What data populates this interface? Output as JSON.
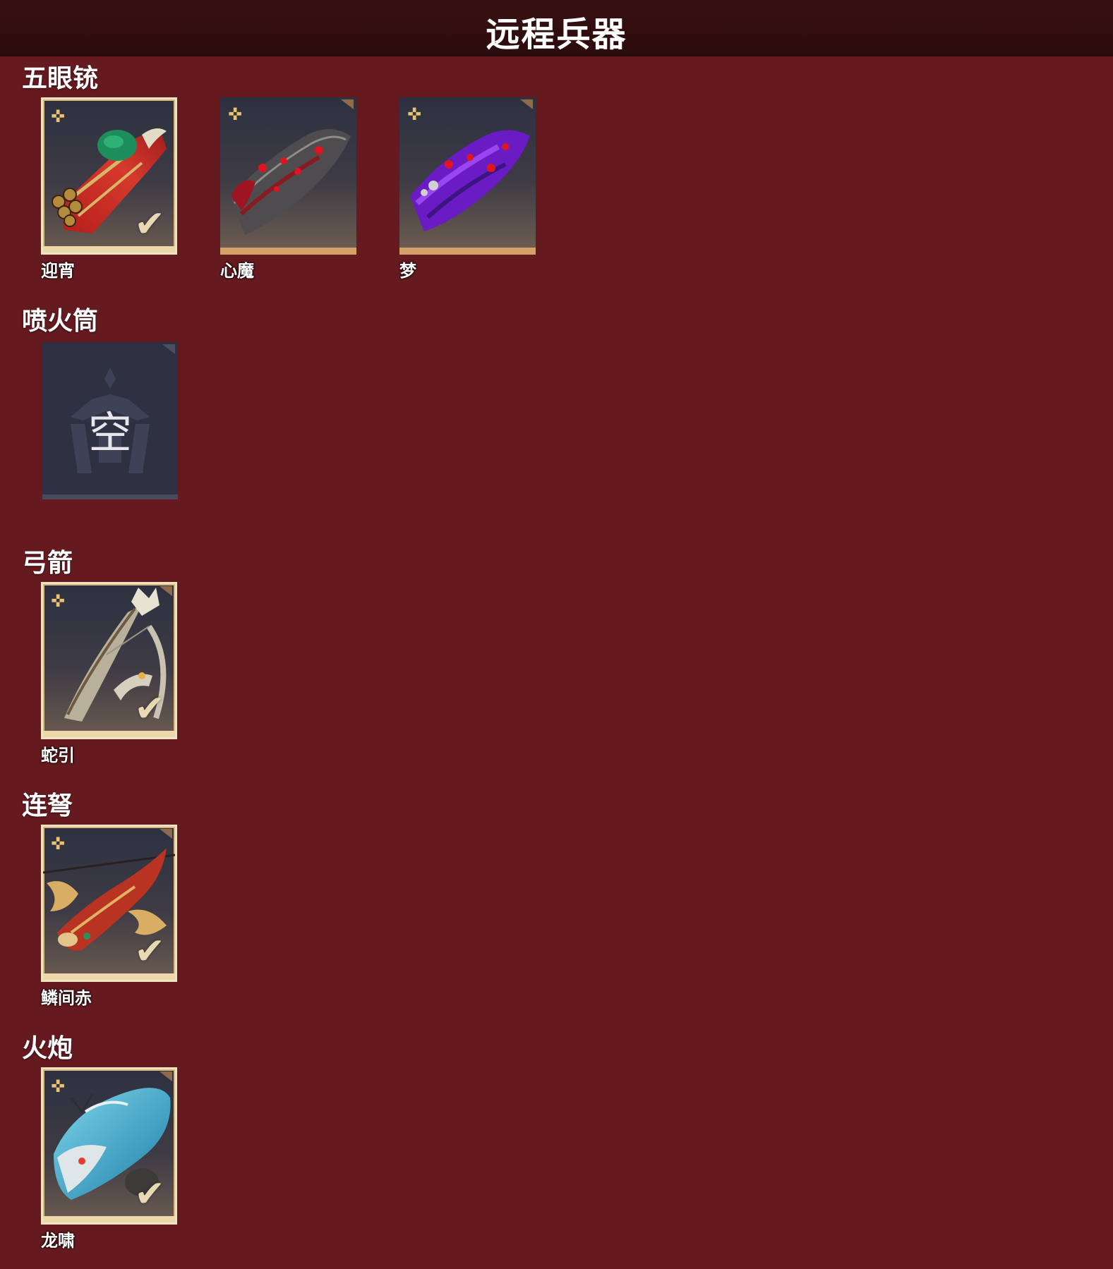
{
  "header": {
    "title": "远程兵器"
  },
  "sections": [
    {
      "title": "五眼铳",
      "items": [
        {
          "name": "迎宵",
          "selected": true,
          "icon": "gatling-gun-red-green-icon",
          "colors": [
            "#c3241e",
            "#1c8e5c",
            "#c9a24a"
          ]
        },
        {
          "name": "心魔",
          "selected": false,
          "icon": "gatling-gun-dark-red-icon",
          "colors": [
            "#7a1218",
            "#5d5b5c",
            "#d8141f"
          ]
        },
        {
          "name": "梦",
          "selected": false,
          "icon": "gatling-gun-purple-icon",
          "colors": [
            "#7b1fd6",
            "#3b1c73",
            "#d3151d"
          ]
        }
      ]
    },
    {
      "title": "喷火筒",
      "items": [
        {
          "name": "",
          "empty": true,
          "empty_text": "空",
          "icon": "empty-slot-icon"
        }
      ]
    },
    {
      "title": "弓箭",
      "items": [
        {
          "name": "蛇引",
          "selected": true,
          "icon": "bow-arrow-silver-icon",
          "colors": [
            "#cfc7b3",
            "#6d5a43",
            "#b19864"
          ]
        }
      ]
    },
    {
      "title": "连弩",
      "items": [
        {
          "name": "鳞间赤",
          "selected": true,
          "icon": "crossbow-koi-red-icon",
          "colors": [
            "#b93322",
            "#e2b468",
            "#3f2f2c"
          ]
        }
      ]
    },
    {
      "title": "火炮",
      "items": [
        {
          "name": "龙啸",
          "selected": true,
          "icon": "cannon-dragon-cyan-icon",
          "colors": [
            "#35b9d6",
            "#d9e5e8",
            "#1b6fa0"
          ]
        }
      ]
    }
  ],
  "icons": {
    "star": "✜",
    "check": "✔"
  }
}
